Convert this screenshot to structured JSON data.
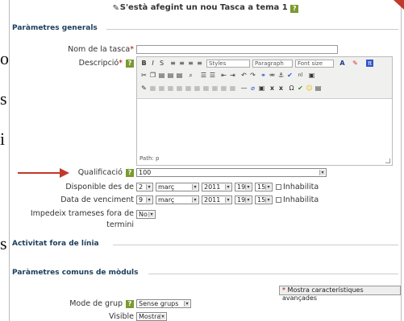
{
  "side_letters": [
    "o",
    "s",
    "i",
    "s"
  ],
  "title": "S'està afegint un nou Tasca a tema 1",
  "sections": {
    "general": "Paràmetres generals",
    "offline": "Activitat fora de línia",
    "common": "Paràmetres comuns de mòduls"
  },
  "fields": {
    "name_label": "Nom de la tasca",
    "description_label": "Descripció",
    "required_mark": "*",
    "grade_label": "Qualificació",
    "grade_value": "100",
    "available_label": "Disponible des de",
    "due_label": "Data de venciment",
    "prevent_label_1": "Impedeix trameses fora de",
    "prevent_label_2": "termini",
    "prevent_value": "No",
    "group_mode_label": "Mode de grup",
    "group_mode_value": "Sense grups",
    "visible_label": "Visible",
    "visible_value": "Mostra",
    "disable_label": "Inhabilita"
  },
  "available_date": {
    "day": "2",
    "month": "març",
    "year": "2011",
    "hour": "19",
    "minute": "15"
  },
  "due_date": {
    "day": "9",
    "month": "març",
    "year": "2011",
    "hour": "19",
    "minute": "15"
  },
  "editor": {
    "styles": "Styles",
    "paragraph": "Paragraph",
    "fontsize": "Font size",
    "path": "Path: p"
  },
  "advanced_button": "Mostra característiques avançades",
  "help_icon": "?",
  "colors": {
    "accent": "#1a3d5c",
    "help": "#7a9a2e",
    "arrow": "#c0392b"
  }
}
